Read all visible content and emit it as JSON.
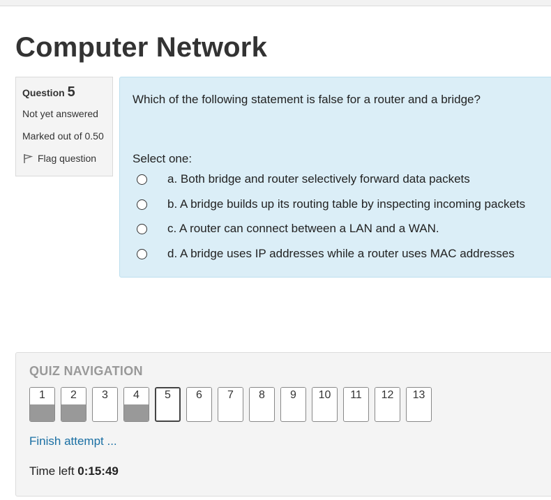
{
  "page": {
    "title": "Computer Network"
  },
  "question_info": {
    "label": "Question",
    "number": "5",
    "state": "Not yet answered",
    "marks": "Marked out of 0.50",
    "flag_label": "Flag question"
  },
  "question": {
    "text": "Which of the following statement is false for a router and a bridge?",
    "prompt": "Select one:",
    "answers": [
      {
        "label": "a. Both bridge and router selectively forward data packets",
        "selected": false
      },
      {
        "label": "b. A bridge builds up its routing table by inspecting incoming packets",
        "selected": false
      },
      {
        "label": "c. A router can connect between a LAN and a WAN.",
        "selected": false
      },
      {
        "label": "d. A bridge uses IP addresses while a router uses MAC addresses",
        "selected": false
      }
    ]
  },
  "quiz_navigation": {
    "title": "QUIZ NAVIGATION",
    "buttons": [
      {
        "label": "1",
        "state": "answered"
      },
      {
        "label": "2",
        "state": "answered"
      },
      {
        "label": "3",
        "state": "unanswered"
      },
      {
        "label": "4",
        "state": "answered"
      },
      {
        "label": "5",
        "state": "current"
      },
      {
        "label": "6",
        "state": "unanswered"
      },
      {
        "label": "7",
        "state": "unanswered"
      },
      {
        "label": "8",
        "state": "unanswered"
      },
      {
        "label": "9",
        "state": "unanswered"
      },
      {
        "label": "10",
        "state": "unanswered"
      },
      {
        "label": "11",
        "state": "unanswered"
      },
      {
        "label": "12",
        "state": "unanswered"
      },
      {
        "label": "13",
        "state": "unanswered"
      }
    ],
    "finish_link": "Finish attempt ...",
    "time_left_label": "Time left",
    "time_left_value": "0:15:49"
  },
  "icons": {
    "flag": "flag-icon"
  },
  "colors": {
    "question_bg": "#dbeef7",
    "link": "#1a6fa3",
    "answered_fill": "#999999"
  }
}
